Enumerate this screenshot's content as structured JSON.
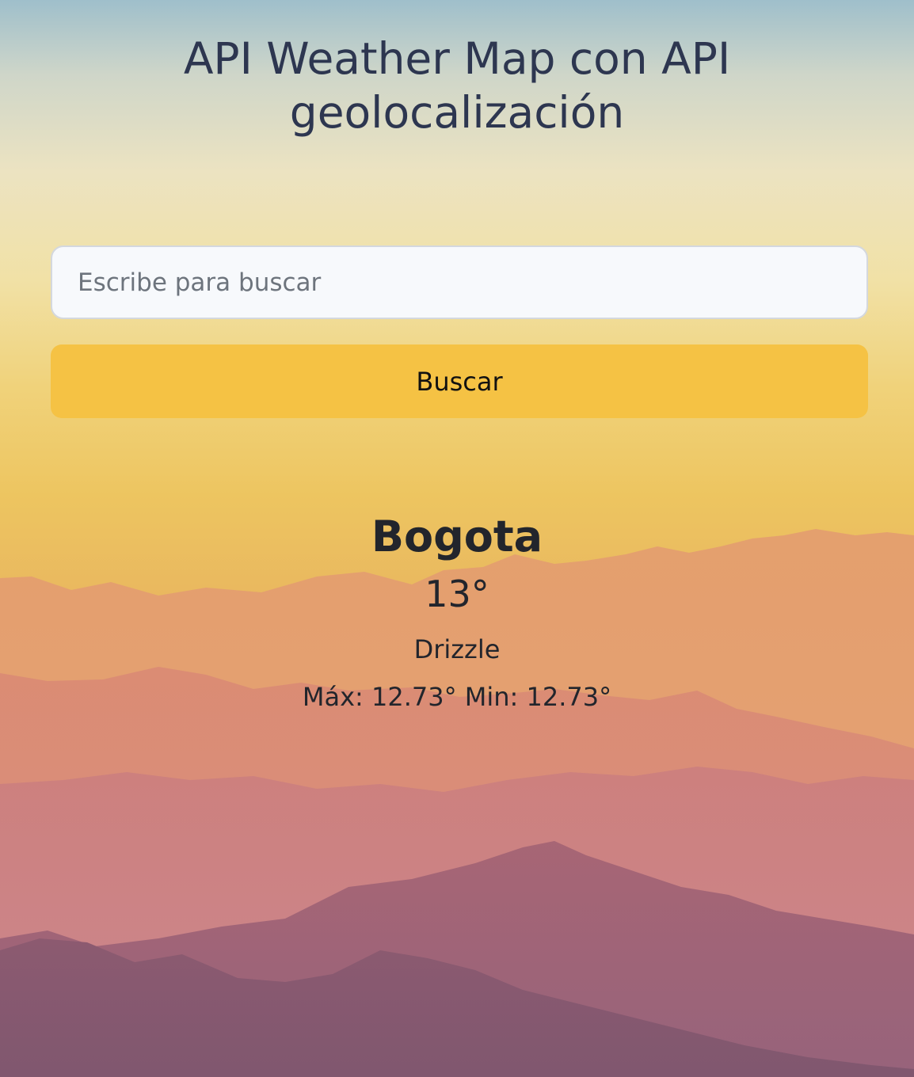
{
  "header": {
    "title_line1": "API Weather Map con API",
    "title_line2": "geolocalización"
  },
  "search": {
    "placeholder": "Escribe para buscar",
    "value": "",
    "button_label": "Buscar"
  },
  "weather": {
    "city": "Bogota",
    "temperature": "13°",
    "description": "Drizzle",
    "max_label": "Máx:",
    "max_value": "12.73°",
    "min_label": "Min:",
    "min_value": "12.73°"
  },
  "colors": {
    "button": "#f5c244",
    "title": "#2d3650",
    "input_bg": "#f7f9fc"
  }
}
